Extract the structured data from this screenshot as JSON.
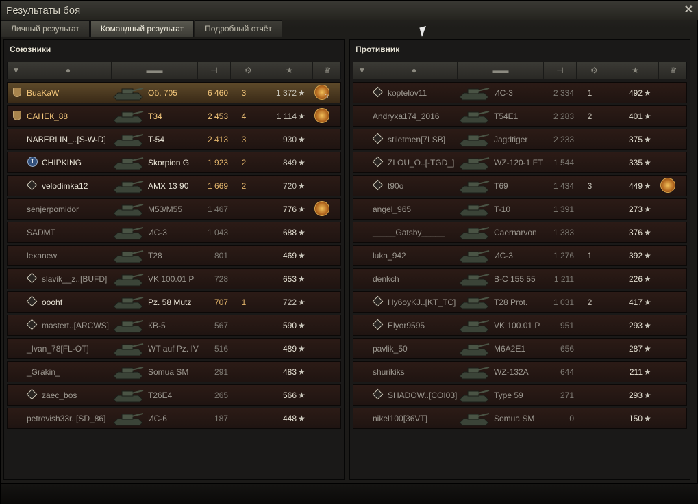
{
  "window": {
    "title": "Результаты боя"
  },
  "tabs": [
    {
      "label": "Личный результат",
      "active": false
    },
    {
      "label": "Командный результат",
      "active": true
    },
    {
      "label": "Подробный отчёт",
      "active": false
    }
  ],
  "allies": {
    "title": "Союзники",
    "rows": [
      {
        "name": "BuaKaW",
        "vehicle": "Об. 705",
        "damage": "6 460",
        "frags": "3",
        "xp": "1 372",
        "medal": true,
        "medal_count": "3",
        "platoon": true,
        "style": "highlight hl-txt"
      },
      {
        "name": "САНЕК_88",
        "vehicle": "T34",
        "damage": "2 453",
        "frags": "4",
        "xp": "1 114",
        "medal": true,
        "platoon": true,
        "style": "hl-txt"
      },
      {
        "name": "NABERLIN_..[S-W-D]",
        "vehicle": "T-54",
        "damage": "2 413",
        "frags": "3",
        "xp": "930",
        "style": "bright gold-dmg"
      },
      {
        "name": "CHIPKING",
        "vehicle": "Skorpion G",
        "damage": "1 923",
        "frags": "2",
        "xp": "849",
        "clan": "round",
        "style": "bright gold-dmg"
      },
      {
        "name": "velodimka12",
        "vehicle": "AMX 13 90",
        "damage": "1 669",
        "frags": "2",
        "xp": "720",
        "clan": "diamond",
        "style": "bright gold-dmg"
      },
      {
        "name": "senjerpomidor",
        "vehicle": "M53/M55",
        "damage": "1 467",
        "frags": "",
        "xp": "776",
        "medal": true,
        "style": "dim"
      },
      {
        "name": "SADMT",
        "vehicle": "ИС-3",
        "damage": "1 043",
        "frags": "",
        "xp": "688",
        "style": "dim"
      },
      {
        "name": "lexanew",
        "vehicle": "T28",
        "damage": "801",
        "frags": "",
        "xp": "469",
        "style": "dim"
      },
      {
        "name": "slavik__z..[BUFD]",
        "vehicle": "VK 100.01 P",
        "damage": "728",
        "frags": "",
        "xp": "653",
        "clan": "diamond",
        "style": "dim"
      },
      {
        "name": "ooohf",
        "vehicle": "Pz. 58 Mutz",
        "damage": "707",
        "frags": "1",
        "xp": "722",
        "clan": "diamond",
        "style": "bright gold-dmg"
      },
      {
        "name": "mastert..[ARCWS]",
        "vehicle": "КВ-5",
        "damage": "567",
        "frags": "",
        "xp": "590",
        "clan": "diamond",
        "style": "dim"
      },
      {
        "name": "_Ivan_78[FL-OT]",
        "vehicle": "WT auf Pz. IV",
        "damage": "516",
        "frags": "",
        "xp": "489",
        "style": "dim"
      },
      {
        "name": "_Grakin_",
        "vehicle": "Somua SM",
        "damage": "291",
        "frags": "",
        "xp": "483",
        "style": "dim"
      },
      {
        "name": "zaec_bos",
        "vehicle": "T26E4",
        "damage": "265",
        "frags": "",
        "xp": "566",
        "clan": "diamond",
        "style": "dim"
      },
      {
        "name": "petrovish33r..[SD_86]",
        "vehicle": "ИС-6",
        "damage": "187",
        "frags": "",
        "xp": "448",
        "style": "dim"
      }
    ]
  },
  "enemies": {
    "title": "Противник",
    "rows": [
      {
        "name": "koptelov11",
        "vehicle": "ИС-3",
        "damage": "2 334",
        "frags": "1",
        "xp": "492",
        "clan": "diamond",
        "style": "dim"
      },
      {
        "name": "Andryxa174_2016",
        "vehicle": "T54E1",
        "damage": "2 283",
        "frags": "2",
        "xp": "401",
        "style": "dim"
      },
      {
        "name": "stiletmen[7LSB]",
        "vehicle": "Jagdtiger",
        "damage": "2 233",
        "frags": "",
        "xp": "375",
        "clan": "diamond",
        "style": "dim"
      },
      {
        "name": "ZLOU_O..[-TGD_]",
        "vehicle": "WZ-120-1 FT",
        "damage": "1 544",
        "frags": "",
        "xp": "335",
        "clan": "diamond",
        "style": "dim"
      },
      {
        "name": "t90o",
        "vehicle": "T69",
        "damage": "1 434",
        "frags": "3",
        "xp": "449",
        "medal": true,
        "clan": "diamond",
        "style": "dim"
      },
      {
        "name": "angel_965",
        "vehicle": "T-10",
        "damage": "1 391",
        "frags": "",
        "xp": "273",
        "style": "dim"
      },
      {
        "name": "_____Gatsby_____",
        "vehicle": "Caernarvon",
        "damage": "1 383",
        "frags": "",
        "xp": "376",
        "style": "dim"
      },
      {
        "name": "luka_942",
        "vehicle": "ИС-3",
        "damage": "1 276",
        "frags": "1",
        "xp": "392",
        "style": "dim"
      },
      {
        "name": "denkch",
        "vehicle": "B-C 155 55",
        "damage": "1 211",
        "frags": "",
        "xp": "226",
        "style": "dim"
      },
      {
        "name": "Hy6oyKJ..[KT_TC]",
        "vehicle": "T28 Prot.",
        "damage": "1 031",
        "frags": "2",
        "xp": "417",
        "clan": "diamond",
        "style": "dim"
      },
      {
        "name": "Elyor9595",
        "vehicle": "VK 100.01 P",
        "damage": "951",
        "frags": "",
        "xp": "293",
        "clan": "diamond",
        "style": "dim"
      },
      {
        "name": "pavlik_50",
        "vehicle": "M6A2E1",
        "damage": "656",
        "frags": "",
        "xp": "287",
        "style": "dim"
      },
      {
        "name": "shurikiks",
        "vehicle": "WZ-132A",
        "damage": "644",
        "frags": "",
        "xp": "211",
        "style": "dim"
      },
      {
        "name": "SHADOW..[COI03]",
        "vehicle": "Type 59",
        "damage": "271",
        "frags": "",
        "xp": "293",
        "clan": "diamond",
        "style": "dim"
      },
      {
        "name": "nikel100[36VT]",
        "vehicle": "Somua SM",
        "damage": "0",
        "frags": "",
        "xp": "150",
        "style": "dim"
      }
    ]
  },
  "icons": {
    "close": "close-icon",
    "star": "★",
    "columns": [
      "platoon-icon",
      "player-icon",
      "tank-icon",
      "damage-icon",
      "frags-icon",
      "xp-star-icon",
      "medal-icon"
    ]
  }
}
